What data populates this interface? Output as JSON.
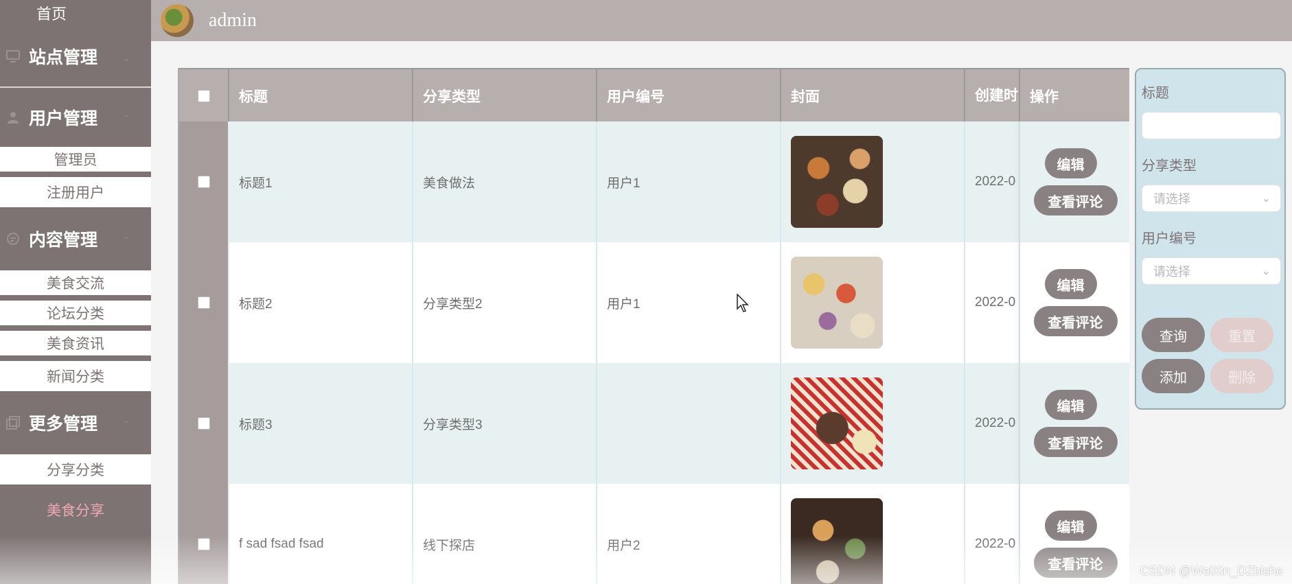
{
  "topbar": {
    "username": "admin"
  },
  "sidebar": {
    "home": "首页",
    "groups": [
      {
        "label": "站点管理",
        "icon": "monitor-icon",
        "items": []
      },
      {
        "label": "用户管理",
        "icon": "user-icon",
        "items": [
          "管理员",
          "注册用户"
        ]
      },
      {
        "label": "内容管理",
        "icon": "chat-icon",
        "items": [
          "美食交流",
          "论坛分类",
          "美食资讯",
          "新闻分类"
        ]
      },
      {
        "label": "更多管理",
        "icon": "copy-icon",
        "items": [
          "分享分类",
          "美食分享"
        ]
      }
    ],
    "active_item": "美食分享"
  },
  "table": {
    "columns": [
      "标题",
      "分享类型",
      "用户编号",
      "封面",
      "创建时",
      "操作"
    ],
    "rows": [
      {
        "title": "标题1",
        "type": "美食做法",
        "user": "用户1",
        "created": "2022-0",
        "cover": "food-image-1"
      },
      {
        "title": "标题2",
        "type": "分享类型2",
        "user": "用户1",
        "created": "2022-0",
        "cover": "food-image-2"
      },
      {
        "title": "标题3",
        "type": "分享类型3",
        "user": "",
        "created": "2022-0",
        "cover": "food-image-3"
      },
      {
        "title": "f sad fsad fsad",
        "type": "线下探店",
        "user": "用户2",
        "created": "2022-0",
        "cover": "food-image-4"
      }
    ],
    "edit_label": "编辑",
    "comments_label": "查看评论"
  },
  "search": {
    "title_label": "标题",
    "type_label": "分享类型",
    "type_placeholder": "请选择",
    "user_label": "用户编号",
    "user_placeholder": "请选择",
    "query_btn": "查询",
    "reset_btn": "重置",
    "add_btn": "添加",
    "delete_btn": "删除"
  },
  "watermark": "CSDN @WeiXin_DZbishe",
  "colors": {
    "sidebar": "#7d7373",
    "header": "#b7aeae",
    "accent_pink": "#f3a7b4",
    "panel": "#cfe4eb"
  }
}
